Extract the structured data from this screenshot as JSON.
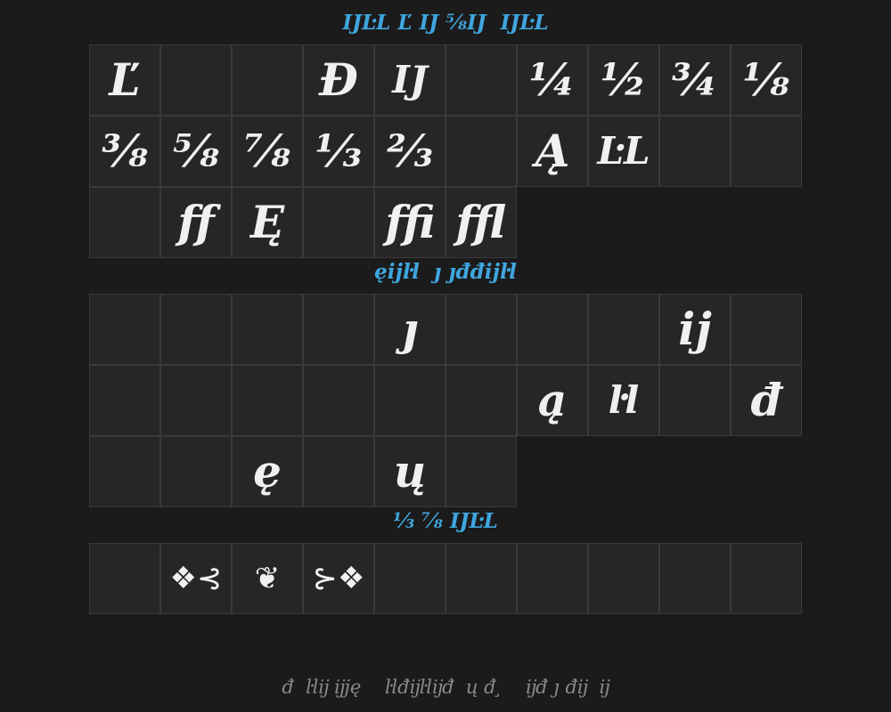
{
  "sections": [
    {
      "header": "IJĿL Ľ IJ ⅝IJ  IJĿL",
      "glyphs": [
        "Ľ",
        "",
        "",
        "Đ",
        "IJ",
        "",
        "¼",
        "½",
        "¾",
        "⅛",
        "⅜",
        "⅝",
        "⅞",
        "⅓",
        "⅔",
        "",
        "Ą",
        "ĿL",
        "",
        "",
        "",
        "ﬀ",
        "Ę",
        "",
        "ﬃ",
        "ﬄ"
      ]
    },
    {
      "header": "ęĳŀl  ȷ ȷđđĳŀl",
      "glyphs": [
        "",
        "",
        "",
        "",
        "ȷ",
        "",
        "",
        "",
        "ĳ",
        "",
        "",
        "",
        "",
        "",
        "",
        "",
        "ą",
        "ŀl",
        "",
        "đ",
        "",
        "",
        "ę",
        "",
        "ų",
        ""
      ]
    },
    {
      "header": "⅓ ⅞ IJĿL",
      "glyphs": [
        "",
        "❖⊰",
        "❦",
        "⊱❖",
        "",
        "",
        "",
        "",
        "",
        ""
      ]
    }
  ],
  "footer": "đ  ŀlĳ ĳję    ŀlđĳŀlĳđ  ų đ ̧    ĳđ ȷ đĳ  ĳ"
}
